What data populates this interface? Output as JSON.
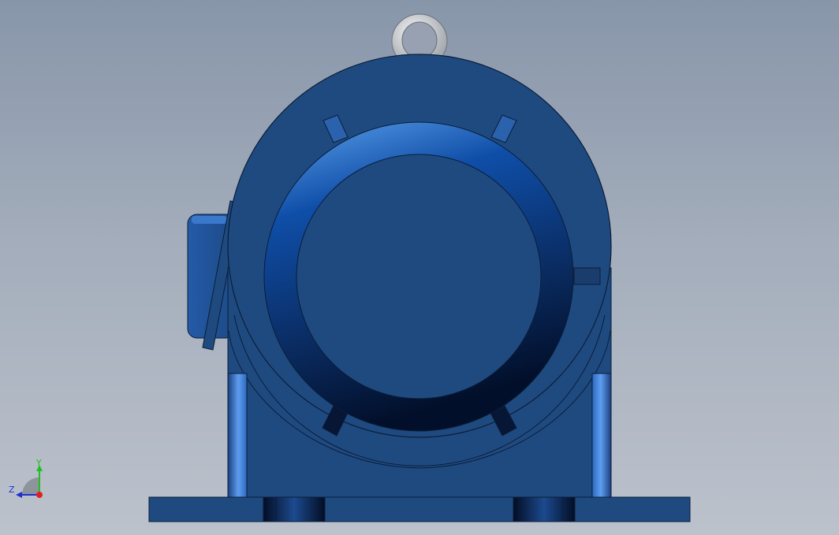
{
  "window": {
    "title": ""
  },
  "viewport": {
    "background_top": "#8896aa",
    "background_bottom": "#bcc2cc",
    "model_color": "#1f4a80"
  },
  "model": {
    "name": "motor-housing-front-view",
    "parts": [
      "lifting-eye-bolt",
      "motor-frame",
      "end-shield",
      "bearing-cover",
      "terminal-box",
      "mounting-feet",
      "base-plate"
    ]
  },
  "triad": {
    "y_label": "Y",
    "z_label": "Z",
    "x_color": "#e02020",
    "y_color": "#20c020",
    "z_color": "#2030d0"
  }
}
